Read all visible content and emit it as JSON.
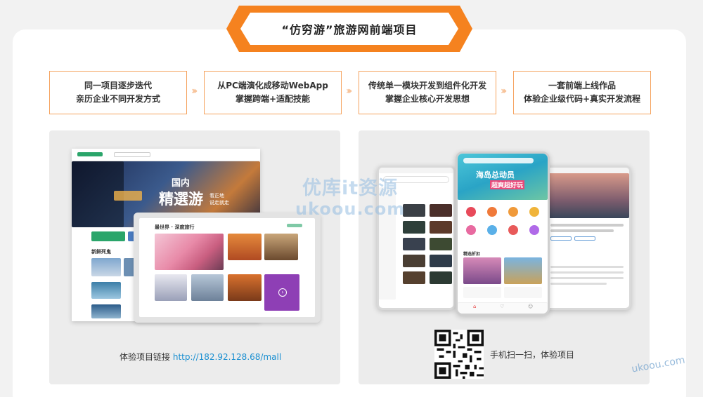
{
  "banner": {
    "title": "“仿穷游”旅游网前端项目"
  },
  "features": [
    {
      "line1": "同一项目逐步迭代",
      "line2": "亲历企业不同开发方式"
    },
    {
      "line1": "从PC端演化成移动WebApp",
      "line2": "掌握跨端+适配技能"
    },
    {
      "line1": "传统单一模块开发到组件化开发",
      "line2": "掌握企业核心开发思想"
    },
    {
      "line1": "一套前端上线作品",
      "line2": "体验企业级代码+真实开发流程"
    }
  ],
  "left_panel": {
    "desktop_hero": {
      "line1": "国内",
      "line2": "精選游",
      "line3": "看正地",
      "line4": "说走就走"
    },
    "desktop_section": "新鲜死鬼",
    "tablet_title": "最世界 · 深度旅行",
    "link_label": "体验项目链接",
    "link_url": "http://182.92.128.68/mall"
  },
  "right_panel": {
    "phone_banner_line1": "海岛总动员",
    "phone_banner_line2": "超爽超好玩",
    "phone_section": "精选折扣",
    "qr_caption": "手机扫一扫，体验项目"
  },
  "watermarks": {
    "line1": "优库it资源",
    "line2": "ukoou.com",
    "corner": "ukoou.com"
  },
  "colors": {
    "accent": "#f5821f",
    "feature_border": "#f5a25d",
    "link": "#1a8fd1"
  }
}
